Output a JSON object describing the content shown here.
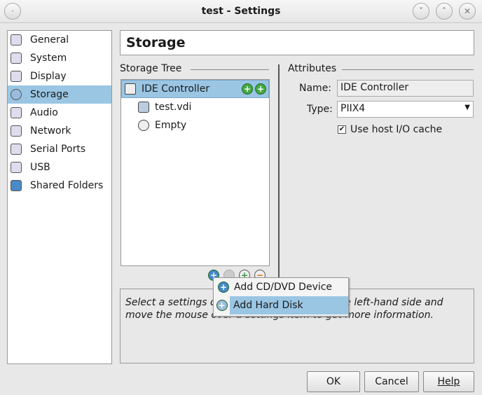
{
  "window": {
    "title": "test - Settings"
  },
  "sidebar": {
    "items": [
      {
        "label": "General",
        "icon": "general-icon"
      },
      {
        "label": "System",
        "icon": "system-icon"
      },
      {
        "label": "Display",
        "icon": "display-icon"
      },
      {
        "label": "Storage",
        "icon": "storage-icon",
        "selected": true
      },
      {
        "label": "Audio",
        "icon": "audio-icon"
      },
      {
        "label": "Network",
        "icon": "network-icon"
      },
      {
        "label": "Serial Ports",
        "icon": "serial-ports-icon"
      },
      {
        "label": "USB",
        "icon": "usb-icon"
      },
      {
        "label": "Shared Folders",
        "icon": "shared-folders-icon"
      }
    ]
  },
  "page": {
    "title": "Storage"
  },
  "storage_tree": {
    "label": "Storage Tree",
    "controller": "IDE Controller",
    "children": [
      "test.vdi",
      "Empty"
    ]
  },
  "attributes": {
    "label": "Attributes",
    "name_label": "Name:",
    "name_value": "IDE Controller",
    "type_label": "Type:",
    "type_value": "PIIX4",
    "cache_label": "Use host I/O cache",
    "cache_checked": true
  },
  "info": {
    "text": "Select a settings category from the list on the left-hand side and move the mouse over a settings item to get more information."
  },
  "context_menu": {
    "items": [
      "Add CD/DVD Device",
      "Add Hard Disk"
    ]
  },
  "buttons": {
    "ok": "OK",
    "cancel": "Cancel",
    "help": "Help"
  }
}
